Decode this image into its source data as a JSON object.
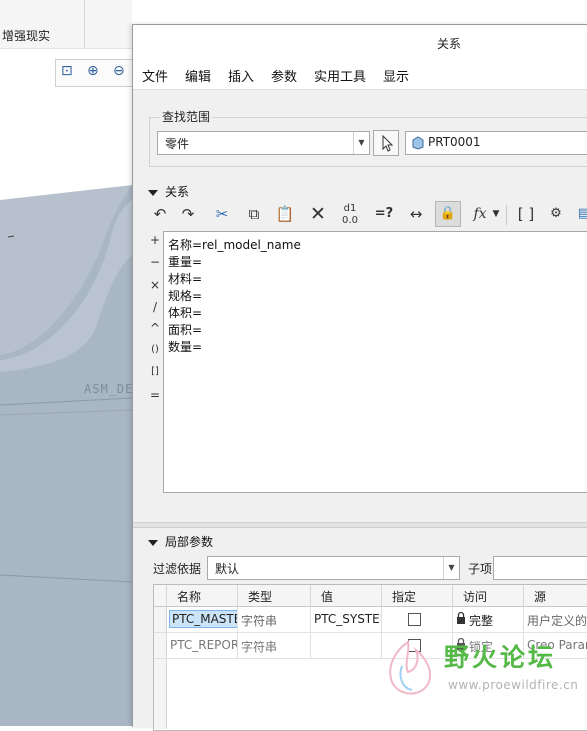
{
  "background": {
    "ribbon_label": "增强现实",
    "model_label": "ASM_DE",
    "model_color": "#a9b6c4"
  },
  "dialog": {
    "title": "关系",
    "menu": [
      "文件",
      "编辑",
      "插入",
      "参数",
      "实用工具",
      "显示"
    ]
  },
  "scope": {
    "group_label": "查找范围",
    "type_value": "零件",
    "part_value": "PRT0001"
  },
  "relations": {
    "section_label": "关系",
    "operators": [
      "+",
      "−",
      "×",
      "/",
      "^",
      "()",
      "[]",
      "="
    ],
    "lines": [
      "名称=rel_model_name",
      "重量=",
      "材料=",
      "规格=",
      "体积=",
      "面积=",
      "数量="
    ],
    "icons": [
      "undo-icon",
      "redo-icon",
      "cut-icon",
      "copy-icon",
      "paste-icon",
      "delete-icon",
      "sort-icon",
      "verify-icon",
      "measure-icon",
      "lock-relation-icon",
      "function-icon",
      "brackets-icon",
      "evaluate-icon",
      "parameters-icon"
    ]
  },
  "local_params": {
    "section_label": "局部参数",
    "filter_label": "过滤依据",
    "filter_value": "默认",
    "sub_label": "子项",
    "columns": [
      "名称",
      "类型",
      "值",
      "指定",
      "访问",
      "源"
    ],
    "rows": [
      {
        "name": "PTC_MASTE",
        "type": "字符串",
        "value": "PTC_SYSTEM",
        "access": "完整",
        "source": "用户定义的"
      },
      {
        "name": "PTC_REPOR",
        "type": "字符串",
        "value": "",
        "access": "锁定",
        "source": "Creo Parar"
      }
    ]
  },
  "watermark": {
    "text": "野火论坛",
    "url": "www.proewildfire.cn"
  }
}
